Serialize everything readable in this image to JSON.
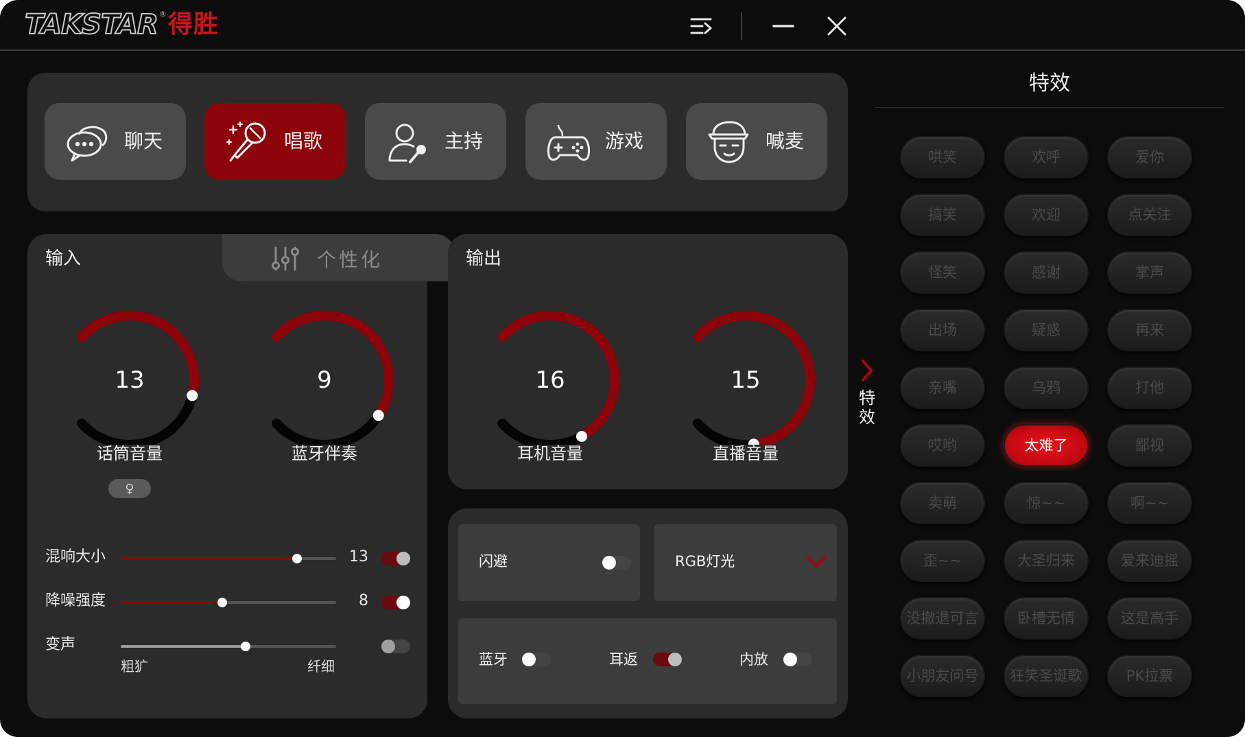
{
  "app": {
    "logo_en": "TAKSTAR",
    "logo_reg": "®",
    "logo_cn": "得胜"
  },
  "colors": {
    "accent": "#8c0309",
    "active_fx": "#d40d16",
    "panel": "#2b2b2b",
    "background": "#0c0c0c"
  },
  "titlebar": {
    "icons": [
      "menu-icon",
      "minimize-icon",
      "close-icon"
    ]
  },
  "modes": [
    {
      "label": "聊天",
      "icon": "chat-bubble-icon",
      "active": false
    },
    {
      "label": "唱歌",
      "icon": "microphone-sparkle-icon",
      "active": true
    },
    {
      "label": "主持",
      "icon": "host-person-icon",
      "active": false
    },
    {
      "label": "游戏",
      "icon": "gamepad-icon",
      "active": false
    },
    {
      "label": "喊麦",
      "icon": "cap-face-icon",
      "active": false
    }
  ],
  "input": {
    "title": "输入",
    "personal_tab": "个性化",
    "knobs": [
      {
        "label": "话筒音量",
        "value": "13",
        "fraction": 0.55
      },
      {
        "label": "蓝牙伴奏",
        "value": "9",
        "fraction": 0.62
      }
    ],
    "mic_chip": "♀",
    "sliders": [
      {
        "label": "混响大小",
        "value": "13",
        "fraction": 0.82,
        "toggle": "on-dim"
      },
      {
        "label": "降噪强度",
        "value": "8",
        "fraction": 0.47,
        "toggle": "on"
      },
      {
        "label": "变声",
        "value": "",
        "fraction": 0.58,
        "toggle": "off-dim",
        "left_label": "粗犷",
        "right_label": "纤细"
      }
    ]
  },
  "output": {
    "title": "输出",
    "knobs": [
      {
        "label": "耳机音量",
        "value": "16",
        "fraction": 0.72
      },
      {
        "label": "直播音量",
        "value": "15",
        "fraction": 0.8
      }
    ],
    "dodge": {
      "label": "闪避",
      "on": false
    },
    "rgb": {
      "label": "RGB灯光"
    },
    "toggles": [
      {
        "label": "蓝牙",
        "on": false
      },
      {
        "label": "耳返",
        "on": true
      },
      {
        "label": "内放",
        "on": false
      }
    ]
  },
  "effects": {
    "title": "特效",
    "side_label": "特效",
    "items": [
      "哄笑",
      "欢呼",
      "爱你",
      "搞笑",
      "欢迎",
      "点关注",
      "怪笑",
      "感谢",
      "掌声",
      "出场",
      "疑惑",
      "再来",
      "亲嘴",
      "乌鸦",
      "打他",
      "哎哟",
      "太难了",
      "鄙视",
      "卖萌",
      "惊~~",
      "啊~~",
      "歪~~",
      "大圣归来",
      "爱来迪摇",
      "没撤退可言",
      "卧槽无情",
      "这是高手",
      "小朋友问号",
      "狂笑圣诞歌",
      "PK拉票"
    ],
    "active_index": 16
  }
}
